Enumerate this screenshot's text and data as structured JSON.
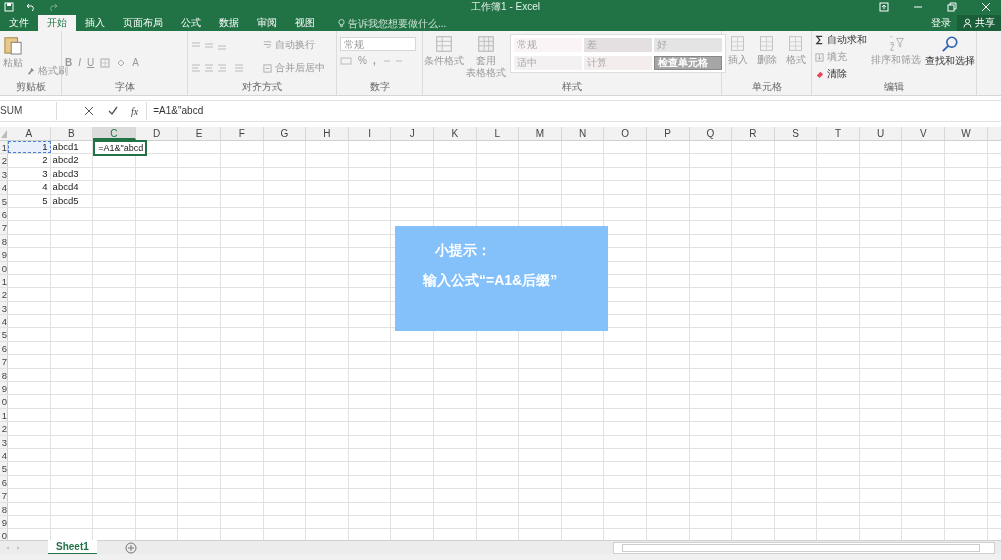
{
  "window": {
    "title": "工作簿1 - Excel"
  },
  "account": {
    "sign_in": "登录",
    "share": "共享"
  },
  "tabs": [
    {
      "label": "文件",
      "selected": false
    },
    {
      "label": "开始",
      "selected": true
    },
    {
      "label": "插入",
      "selected": false
    },
    {
      "label": "页面布局",
      "selected": false
    },
    {
      "label": "公式",
      "selected": false
    },
    {
      "label": "数据",
      "selected": false
    },
    {
      "label": "审阅",
      "selected": false
    },
    {
      "label": "视图",
      "selected": false
    }
  ],
  "tell_me": {
    "placeholder": "告诉我您想要做什么..."
  },
  "ribbon": {
    "clipboard": {
      "label": "剪贴板",
      "paste": "粘贴",
      "format_painter": "格式刷"
    },
    "font": {
      "label": "字体",
      "bold": "B",
      "italic": "I",
      "underline": "U",
      "font_color": "A"
    },
    "alignment": {
      "label": "对齐方式",
      "wrap_text": "自动换行",
      "merge_center": "合并后居中"
    },
    "number": {
      "label": "数字",
      "format": "常规",
      "percent": "%",
      "comma": ","
    },
    "styles": {
      "label": "样式",
      "conditional": "条件格式",
      "table_format": [
        "套用",
        "表格格式"
      ],
      "gallery": [
        {
          "label": "常规",
          "color": "#fbf4f7"
        },
        {
          "label": "差",
          "color": "#e4dfe1"
        },
        {
          "label": "好",
          "color": "#e4e4e4"
        },
        {
          "label": "适中",
          "color": "#f3f1f1"
        },
        {
          "label": "计算",
          "color": "#f3eded"
        },
        {
          "label": "检查单元格",
          "color": "#a6a6a6"
        }
      ]
    },
    "cells": {
      "label": "单元格",
      "insert": "插入",
      "delete": "删除",
      "format": "格式"
    },
    "editing": {
      "label": "编辑",
      "autosum": "自动求和",
      "fill": "填充",
      "clear": "清除",
      "sort_filter": "排序和筛选",
      "find_select": "查找和选择"
    }
  },
  "formula_bar": {
    "name_box": "SUM",
    "fx": "fx",
    "formula": "=A1&\"abcd"
  },
  "sheet": {
    "columns": [
      {
        "label": "A",
        "selected": false
      },
      {
        "label": "B",
        "selected": false
      },
      {
        "label": "C",
        "selected": true
      },
      {
        "label": "D",
        "selected": false
      },
      {
        "label": "E",
        "selected": false
      },
      {
        "label": "F",
        "selected": false
      },
      {
        "label": "G",
        "selected": false
      },
      {
        "label": "H",
        "selected": false
      },
      {
        "label": "I",
        "selected": false
      },
      {
        "label": "J",
        "selected": false
      },
      {
        "label": "K",
        "selected": false
      },
      {
        "label": "L",
        "selected": false
      },
      {
        "label": "M",
        "selected": false
      },
      {
        "label": "N",
        "selected": false
      },
      {
        "label": "O",
        "selected": false
      },
      {
        "label": "P",
        "selected": false
      },
      {
        "label": "Q",
        "selected": false
      },
      {
        "label": "R",
        "selected": false
      },
      {
        "label": "S",
        "selected": false
      },
      {
        "label": "T",
        "selected": false
      },
      {
        "label": "U",
        "selected": false
      },
      {
        "label": "V",
        "selected": false
      },
      {
        "label": "W",
        "selected": false
      }
    ],
    "row_labels": [
      "1",
      "2",
      "3",
      "4",
      "5",
      "6",
      "7",
      "8",
      "9",
      "0",
      "1",
      "2",
      "3",
      "4",
      "5",
      "6",
      "7",
      "8",
      "9",
      "0",
      "1",
      "2",
      "3",
      "4",
      "5",
      "6",
      "7",
      "8",
      "9",
      "0"
    ],
    "rows": [
      {
        "cells": [
          {
            "text": "1",
            "kind": "number",
            "copied": true
          },
          {
            "text": "abcd1",
            "kind": "text",
            "copied": false
          },
          {
            "text": "=A1&\"abcd",
            "kind": "editing",
            "copied": false
          }
        ]
      },
      {
        "cells": [
          {
            "text": "2",
            "kind": "number",
            "copied": false
          },
          {
            "text": "abcd2",
            "kind": "text",
            "copied": false
          }
        ]
      },
      {
        "cells": [
          {
            "text": "3",
            "kind": "number",
            "copied": false
          },
          {
            "text": "abcd3",
            "kind": "text",
            "copied": false
          }
        ]
      },
      {
        "cells": [
          {
            "text": "4",
            "kind": "number",
            "copied": false
          },
          {
            "text": "abcd4",
            "kind": "text",
            "copied": false
          }
        ]
      },
      {
        "cells": [
          {
            "text": "5",
            "kind": "number",
            "copied": false
          },
          {
            "text": "abcd5",
            "kind": "text",
            "copied": false
          }
        ]
      }
    ]
  },
  "tip": {
    "title": "小提示：",
    "body": "输入公式“=A1&后缀”"
  },
  "sheet_tabs": [
    {
      "label": "Sheet1",
      "selected": true
    }
  ]
}
